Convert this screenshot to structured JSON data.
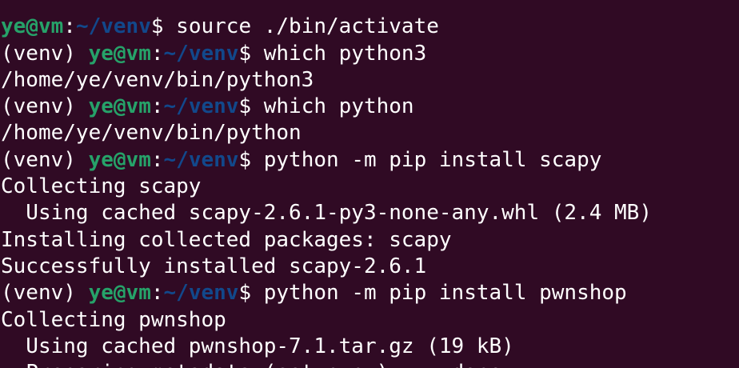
{
  "theme": {
    "background": "#300a24",
    "foreground": "#ffffff",
    "user_color": "#26a269",
    "path_color": "#12488b"
  },
  "terminal": {
    "lines": [
      {
        "type": "output",
        "text": "                    "
      },
      {
        "type": "prompt",
        "venv": "",
        "user": "ye@vm",
        "sep": ":",
        "path": "~/venv",
        "symbol": "$ ",
        "command": "source ./bin/activate"
      },
      {
        "type": "prompt",
        "venv": "(venv) ",
        "user": "ye@vm",
        "sep": ":",
        "path": "~/venv",
        "symbol": "$ ",
        "command": "which python3"
      },
      {
        "type": "output",
        "text": "/home/ye/venv/bin/python3"
      },
      {
        "type": "prompt",
        "venv": "(venv) ",
        "user": "ye@vm",
        "sep": ":",
        "path": "~/venv",
        "symbol": "$ ",
        "command": "which python"
      },
      {
        "type": "output",
        "text": "/home/ye/venv/bin/python"
      },
      {
        "type": "prompt",
        "venv": "(venv) ",
        "user": "ye@vm",
        "sep": ":",
        "path": "~/venv",
        "symbol": "$ ",
        "command": "python -m pip install scapy"
      },
      {
        "type": "output",
        "text": "Collecting scapy"
      },
      {
        "type": "output",
        "text": "  Using cached scapy-2.6.1-py3-none-any.whl (2.4 MB)"
      },
      {
        "type": "output",
        "text": "Installing collected packages: scapy"
      },
      {
        "type": "output",
        "text": "Successfully installed scapy-2.6.1"
      },
      {
        "type": "prompt",
        "venv": "(venv) ",
        "user": "ye@vm",
        "sep": ":",
        "path": "~/venv",
        "symbol": "$ ",
        "command": "python -m pip install pwnshop"
      },
      {
        "type": "output",
        "text": "Collecting pwnshop"
      },
      {
        "type": "output",
        "text": "  Using cached pwnshop-7.1.tar.gz (19 kB)"
      },
      {
        "type": "output",
        "text": "  Preparing metadata (setup.py) ... done"
      }
    ]
  }
}
